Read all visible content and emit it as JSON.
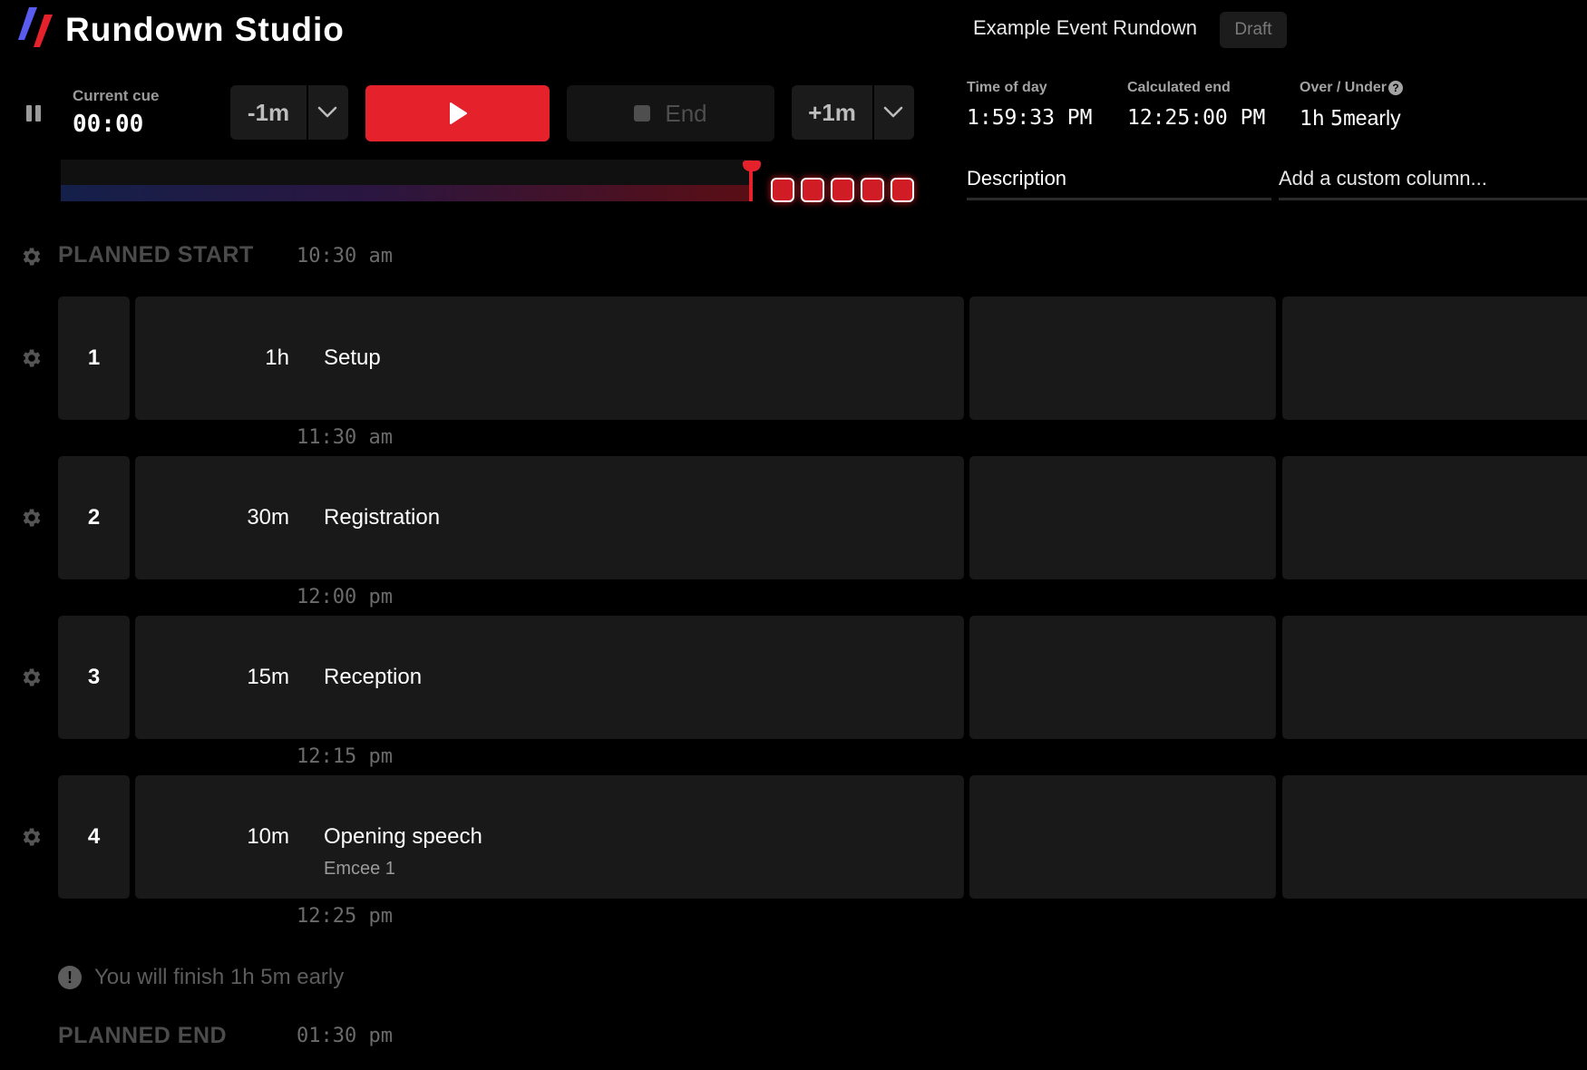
{
  "header": {
    "app_title": "Rundown Studio",
    "event_title": "Example Event Rundown",
    "status_badge": "Draft",
    "logo_icon": "slash-stripes-logo",
    "brand_colors": [
      "#5a5cf0",
      "#e5222c"
    ]
  },
  "controls": {
    "pause_icon": "pause-icon",
    "current_cue_label": "Current cue",
    "current_cue_time": "00:00",
    "minus_label": "-1m",
    "plus_label": "+1m",
    "play_icon": "play-icon",
    "end_label": "End",
    "accent_color": "#e5222c"
  },
  "clock": {
    "time_of_day_label": "Time of day",
    "time_of_day": "1:59:33 PM",
    "calculated_end_label": "Calculated end",
    "calculated_end": "12:25:00 PM",
    "over_under_label": "Over / Under",
    "over_under_hours": "1h",
    "over_under_minutes": "5m",
    "over_under_word": "early"
  },
  "progress": {
    "elapsed_fraction": 1.0,
    "overrun_blocks": 5
  },
  "columns": {
    "description": "Description",
    "custom_placeholder": "Add a custom column..."
  },
  "timeline": {
    "planned_start_label": "PLANNED START",
    "planned_start_time": "10:30  am",
    "planned_end_label": "PLANNED END",
    "planned_end_time": "01:30  pm",
    "finish_note": "You will finish 1h 5m early",
    "cues": [
      {
        "number": "1",
        "duration": "1h",
        "title": "Setup",
        "subtitle": "",
        "end_time": "11:30  am"
      },
      {
        "number": "2",
        "duration": "30m",
        "title": "Registration",
        "subtitle": "",
        "end_time": "12:00  pm"
      },
      {
        "number": "3",
        "duration": "15m",
        "title": "Reception",
        "subtitle": "",
        "end_time": "12:15  pm"
      },
      {
        "number": "4",
        "duration": "10m",
        "title": "Opening speech",
        "subtitle": "Emcee 1",
        "end_time": "12:25  pm"
      }
    ]
  }
}
